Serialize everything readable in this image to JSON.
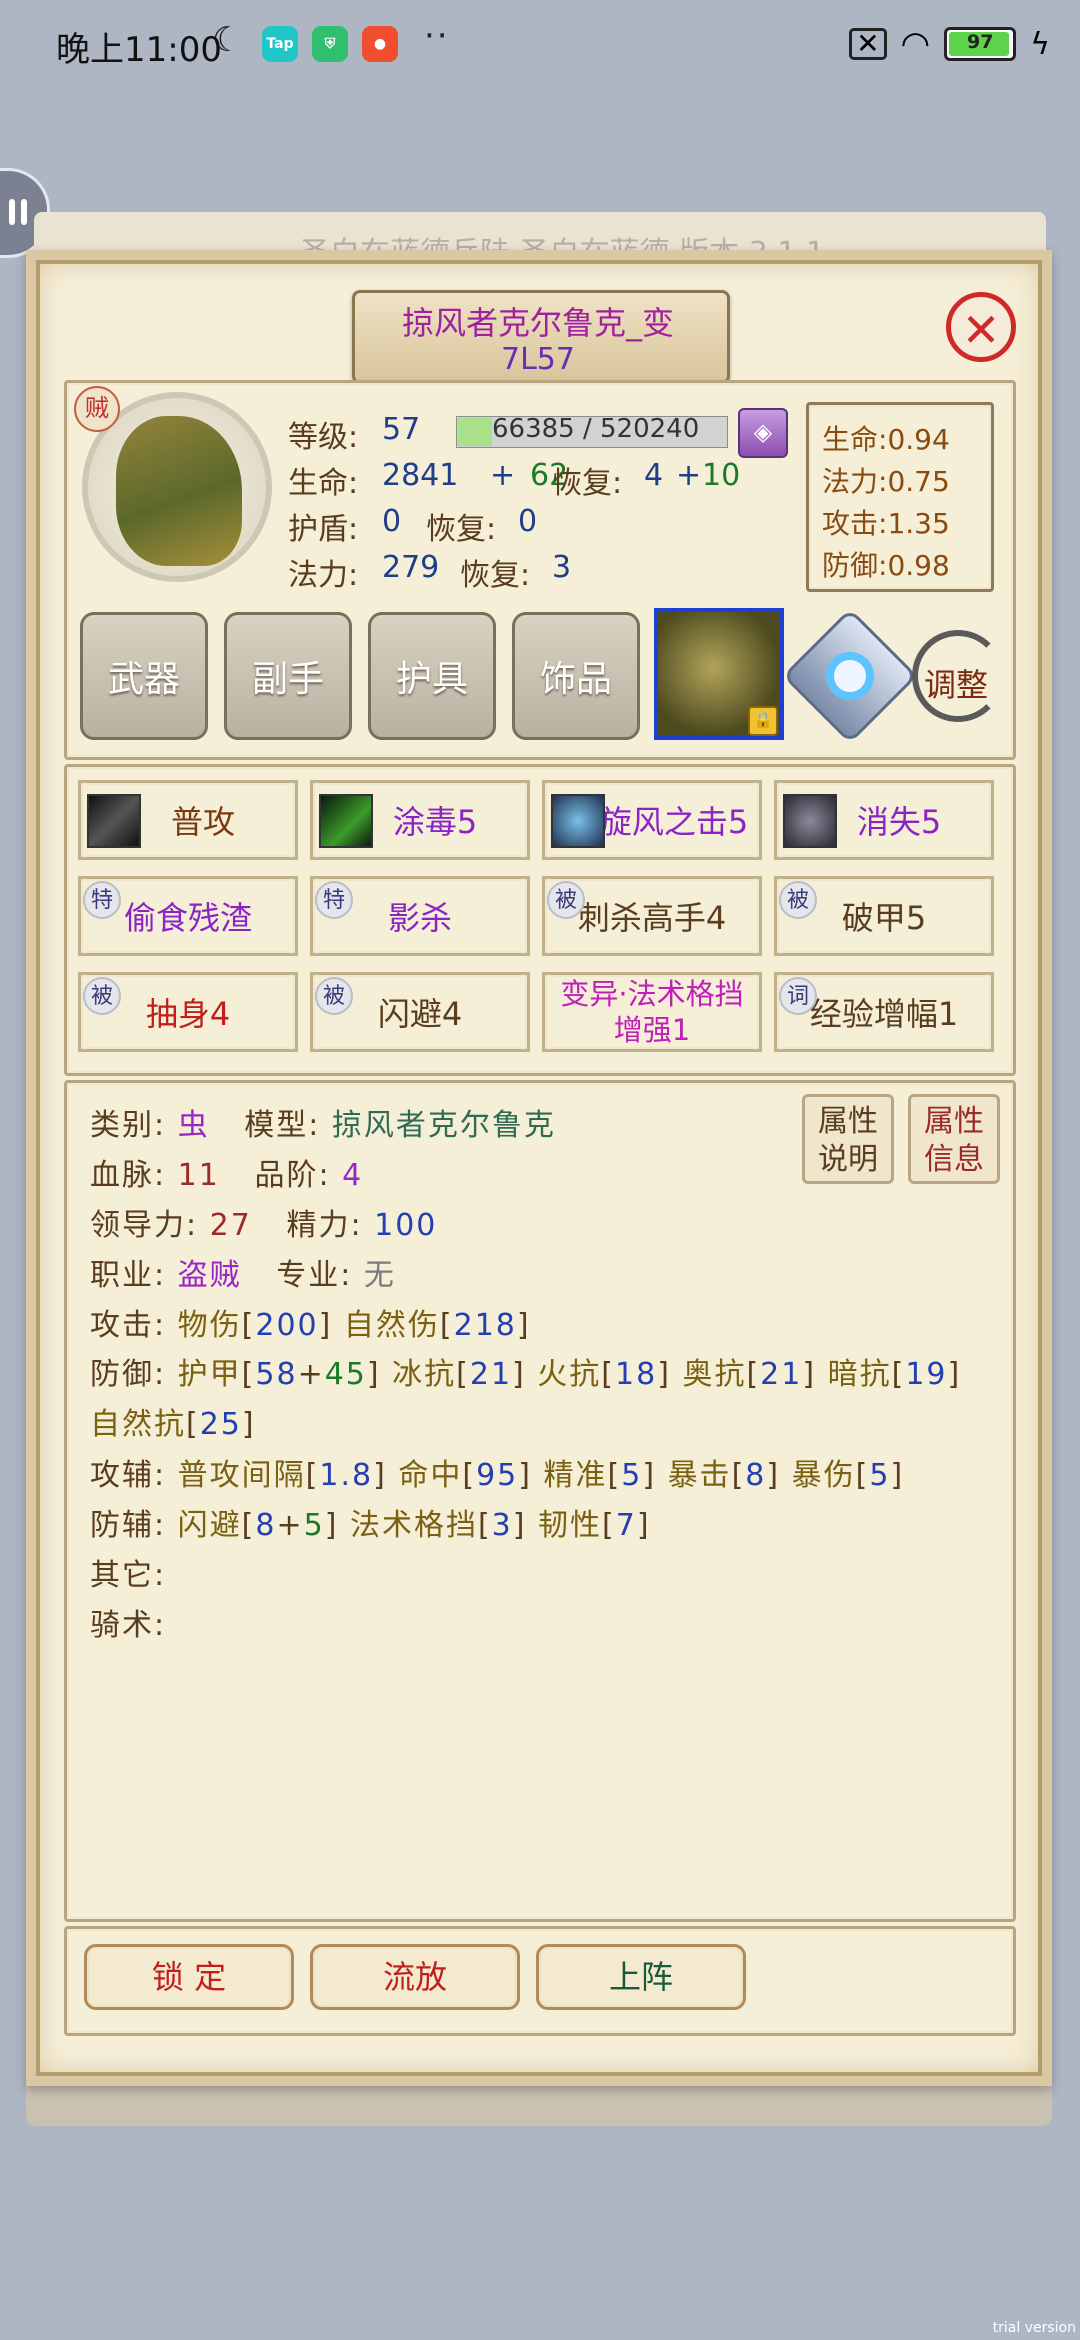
{
  "status_bar": {
    "time": "晚上11:00",
    "battery": "97",
    "app_tap": "Tap"
  },
  "background": {
    "strip_text": "圣白在蓝德兵陆 圣白在蓝德 版本 3.1.1"
  },
  "title": {
    "name": "掠风者克尔鲁克_变",
    "code": "7L57"
  },
  "avatar": {
    "class_badge": "贼"
  },
  "level": {
    "label": "等级:",
    "value": "57",
    "exp_text": "66385 / 520240",
    "exp_progress": 0.128
  },
  "hp": {
    "label": "生命:",
    "base": "2841",
    "plus": "+",
    "bonus": "62",
    "regen_label": "恢复:",
    "regen_base": "4",
    "regen_plus": "+",
    "regen_bonus": "10"
  },
  "shield": {
    "label": "护盾:",
    "value": "0",
    "regen_label": "恢复:",
    "regen_value": "0"
  },
  "mana": {
    "label": "法力:",
    "value": "279",
    "regen_label": "恢复:",
    "regen_value": "3"
  },
  "growth": [
    {
      "label": "生命:",
      "value": "0.94"
    },
    {
      "label": "法力:",
      "value": "0.75"
    },
    {
      "label": "攻击:",
      "value": "1.35"
    },
    {
      "label": "防御:",
      "value": "0.98"
    }
  ],
  "equipment": [
    "武器",
    "副手",
    "护具",
    "饰品"
  ],
  "adjust_label": "调整",
  "skills": [
    {
      "name": "普攻",
      "badge": "",
      "color": "#7a3a10"
    },
    {
      "name": "涂毒5",
      "badge": "",
      "color": "#8a24c4"
    },
    {
      "name": "旋风之击5",
      "badge": "",
      "color": "#8a24c4"
    },
    {
      "name": "消失5",
      "badge": "",
      "color": "#8a24c4"
    },
    {
      "name": "偷食残渣",
      "badge": "特",
      "color": "#8a24c4"
    },
    {
      "name": "影杀",
      "badge": "特",
      "color": "#8a24c4"
    },
    {
      "name": "刺杀高手4",
      "badge": "被",
      "color": "#5a3c1e"
    },
    {
      "name": "破甲5",
      "badge": "被",
      "color": "#5a3c1e"
    },
    {
      "name": "抽身4",
      "badge": "被",
      "color": "#c0201c"
    },
    {
      "name": "闪避4",
      "badge": "被",
      "color": "#5a3c1e"
    },
    {
      "name": "变异·法术格挡\n增强1",
      "badge": "",
      "color": "#c020b8"
    },
    {
      "name": "经验增幅1",
      "badge": "词",
      "color": "#5a3c1e"
    }
  ],
  "attrs": {
    "type_label": "类别:",
    "type_value": "虫",
    "model_label": "模型:",
    "model_value": "掠风者克尔鲁克",
    "blood_label": "血脉:",
    "blood_value": "11",
    "grade_label": "品阶:",
    "grade_value": "4",
    "lead_label": "领导力:",
    "lead_value": "27",
    "energy_label": "精力:",
    "energy_value": "100",
    "job_label": "职业:",
    "job_value": "盗贼",
    "spec_label": "专业:",
    "spec_value": "无",
    "atk_label": "攻击:",
    "atk_phys": "物伤",
    "atk_phys_v": "200",
    "atk_nat": "自然伤",
    "atk_nat_v": "218",
    "def_label": "防御:",
    "armor": "护甲",
    "armor_v": "58",
    "armor_b": "45",
    "ice": "冰抗",
    "ice_v": "21",
    "fire": "火抗",
    "fire_v": "18",
    "arcane": "奥抗",
    "arcane_v": "21",
    "dark": "暗抗",
    "dark_v": "19",
    "nature": "自然抗",
    "nature_v": "25",
    "atkaux_label": "攻辅:",
    "interval": "普攻间隔",
    "interval_v": "1.8",
    "hit": "命中",
    "hit_v": "95",
    "precise": "精准",
    "precise_v": "5",
    "crit": "暴击",
    "crit_v": "8",
    "critdmg": "暴伤",
    "critdmg_v": "5",
    "defaux_label": "防辅:",
    "dodge": "闪避",
    "dodge_v": "8",
    "dodge_b": "5",
    "block": "法术格挡",
    "block_v": "3",
    "tough": "韧性",
    "tough_v": "7",
    "other_label": "其它:",
    "ride_label": "骑术:"
  },
  "attr_buttons": {
    "explain": "属性\n说明",
    "info": "属性\n信息"
  },
  "actions": {
    "lock": "锁 定",
    "exile": "流放",
    "deploy": "上阵"
  },
  "watermark": "trial version"
}
